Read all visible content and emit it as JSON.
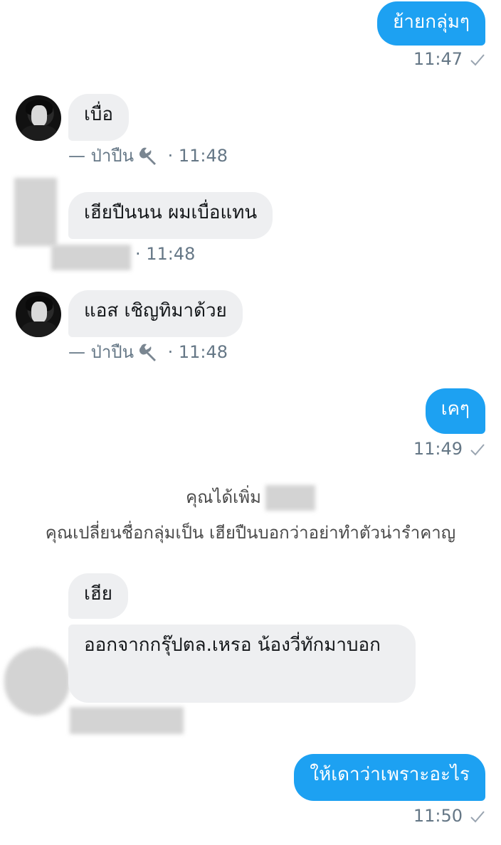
{
  "messages": [
    {
      "text": "ย้ายกลุ่มๆ",
      "time": "11:47"
    },
    {
      "text": "เบื่อ",
      "sender": "— ป่าปืน",
      "time": "11:48"
    },
    {
      "text": "เฮียปืนนน ผมเบื่อแทน",
      "time": "· 11:48"
    },
    {
      "text": "แอส เชิญทิมาด้วย",
      "sender": "— ป่าปืน",
      "time": "11:48"
    },
    {
      "text": "เคๆ",
      "time": "11:49"
    },
    {
      "text": "เฮีย"
    },
    {
      "text": "ออกจากกรุ๊ปตล.เหรอ น้องวี่ทักมาบอก"
    },
    {
      "text": "ให้เดาว่าเพราะอะไร",
      "time": "11:50"
    }
  ],
  "system": {
    "added": "คุณได้เพิ่ม",
    "renamed": "คุณเปลี่ยนชื่อกลุ่มเป็น เฮียปืนบอกว่าอย่าทำตัวน่ารำคาญ"
  },
  "icons": {
    "wrench": "wrench-icon",
    "check": "check-icon"
  },
  "colors": {
    "outgoing_bubble": "#1da1f2",
    "incoming_bubble": "#eeeff1",
    "meta_text": "#657786"
  }
}
